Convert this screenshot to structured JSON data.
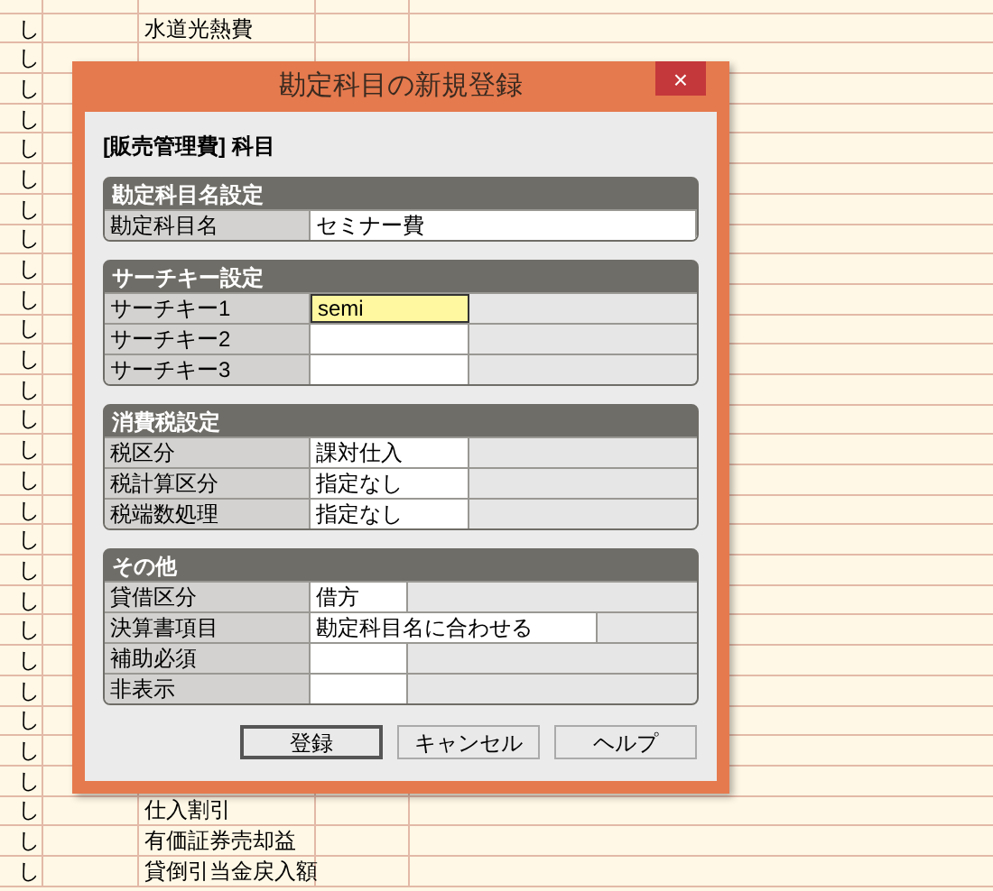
{
  "sheet": {
    "rows": [
      {},
      {
        "mark": "し",
        "name": "水道光熱費"
      },
      {
        "mark": "し"
      },
      {
        "mark": "し"
      },
      {
        "mark": "し"
      },
      {
        "mark": "し"
      },
      {
        "mark": "し"
      },
      {
        "mark": "し"
      },
      {
        "mark": "し"
      },
      {
        "mark": "し"
      },
      {
        "mark": "し"
      },
      {
        "mark": "し"
      },
      {
        "mark": "し"
      },
      {
        "mark": "し"
      },
      {
        "mark": "し"
      },
      {
        "mark": "し"
      },
      {
        "mark": "し"
      },
      {
        "mark": "し"
      },
      {
        "mark": "し"
      },
      {
        "mark": "し"
      },
      {
        "mark": "し"
      },
      {
        "mark": "し"
      },
      {
        "mark": "し"
      },
      {
        "mark": "し"
      },
      {
        "mark": "し"
      },
      {
        "mark": "し"
      },
      {
        "mark": "し"
      },
      {
        "mark": "し",
        "name": "仕入割引"
      },
      {
        "mark": "し",
        "name": "有価証券売却益"
      },
      {
        "mark": "し",
        "name": "貸倒引当金戻入額"
      }
    ]
  },
  "dialog": {
    "title": "勘定科目の新規登録",
    "close": "×",
    "heading": "[販売管理費] 科目",
    "groups": [
      {
        "title": "勘定科目名設定",
        "rows": [
          {
            "label": "勘定科目名",
            "value": "セミナー費",
            "kind": "full"
          }
        ]
      },
      {
        "title": "サーチキー設定",
        "rows": [
          {
            "label": "サーチキー1",
            "value": "semi",
            "kind": "medium",
            "focused": true
          },
          {
            "label": "サーチキー2",
            "kind": "medium",
            "focused": false
          },
          {
            "label": "サーチキー3",
            "kind": "medium",
            "focused": false
          }
        ]
      },
      {
        "title": "消費税設定",
        "rows": [
          {
            "label": "税区分",
            "value": "課対仕入",
            "kind": "medium"
          },
          {
            "label": "税計算区分",
            "value": "指定なし",
            "kind": "medium"
          },
          {
            "label": "税端数処理",
            "value": "指定なし",
            "kind": "medium"
          }
        ]
      },
      {
        "title": "その他",
        "rows": [
          {
            "label": "貸借区分",
            "value": "借方",
            "kind": "short"
          },
          {
            "label": "決算書項目",
            "value": "勘定科目名に合わせる",
            "kind": "long"
          },
          {
            "label": "補助必須",
            "kind": "short"
          },
          {
            "label": "非表示",
            "kind": "short"
          }
        ]
      }
    ],
    "buttons": [
      {
        "label": "登録",
        "default": true
      },
      {
        "label": "キャンセル",
        "default": false
      },
      {
        "label": "ヘルプ",
        "default": false
      }
    ]
  }
}
